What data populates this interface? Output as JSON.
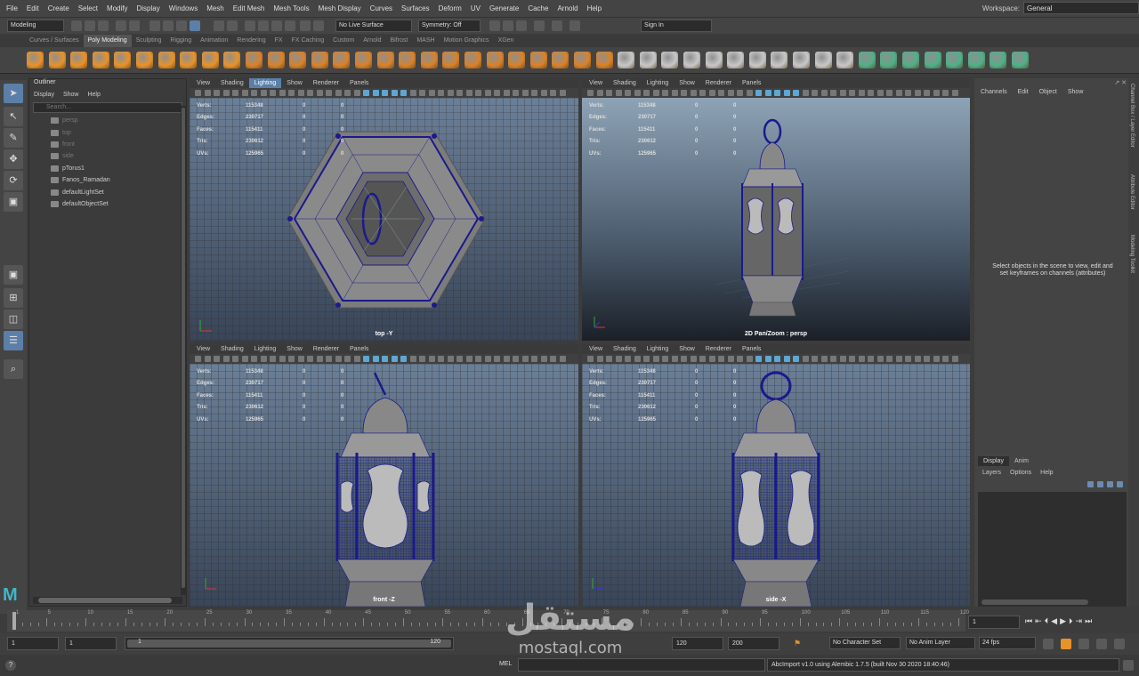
{
  "menubar": {
    "items": [
      "File",
      "Edit",
      "Create",
      "Select",
      "Modify",
      "Display",
      "Windows",
      "Mesh",
      "Edit Mesh",
      "Mesh Tools",
      "Mesh Display",
      "Curves",
      "Surfaces",
      "Deform",
      "UV",
      "Generate",
      "Cache",
      "Arnold",
      "Help"
    ],
    "workspace_label": "Workspace:",
    "workspace_value": "General"
  },
  "statusline": {
    "mode": "Modeling",
    "live_surface": "No Live Surface",
    "symmetry": "Symmetry: Off",
    "signin": "Sign In"
  },
  "shelf": {
    "tabs": [
      "Curves / Surfaces",
      "Poly Modeling",
      "Sculpting",
      "Rigging",
      "Animation",
      "Rendering",
      "FX",
      "FX Caching",
      "Custom",
      "Arnold",
      "Bifrost",
      "MASH",
      "Motion Graphics",
      "XGen"
    ],
    "active_tab": "Poly Modeling"
  },
  "outliner": {
    "title": "Outliner",
    "menu": [
      "Display",
      "Show",
      "Help"
    ],
    "search_placeholder": "Search...",
    "items": [
      {
        "label": "persp",
        "dim": true
      },
      {
        "label": "top",
        "dim": true
      },
      {
        "label": "front",
        "dim": true
      },
      {
        "label": "side",
        "dim": true
      },
      {
        "label": "pTorus1",
        "dim": false
      },
      {
        "label": "Fanos_Ramadan",
        "dim": false
      },
      {
        "label": "defaultLightSet",
        "dim": false
      },
      {
        "label": "defaultObjectSet",
        "dim": false
      }
    ]
  },
  "viewport_menu": [
    "View",
    "Shading",
    "Lighting",
    "Show",
    "Renderer",
    "Panels"
  ],
  "hud": {
    "rows": [
      {
        "k": "Verts:",
        "a": "115348",
        "b": "0",
        "c": "0"
      },
      {
        "k": "Edges:",
        "a": "230717",
        "b": "0",
        "c": "0"
      },
      {
        "k": "Faces:",
        "a": "115411",
        "b": "0",
        "c": "0"
      },
      {
        "k": "Tris:",
        "a": "230612",
        "b": "0",
        "c": "0"
      },
      {
        "k": "UVs:",
        "a": "125965",
        "b": "0",
        "c": "0"
      }
    ]
  },
  "viewports": {
    "top": {
      "label": "top -Y"
    },
    "persp": {
      "label": "2D Pan/Zoom : persp"
    },
    "front": {
      "label": "front -Z"
    },
    "side": {
      "label": "side -X"
    }
  },
  "channelbox": {
    "tabs": [
      "Channels",
      "Edit",
      "Object",
      "Show"
    ],
    "message": "Select objects in the scene to view, edit and set keyframes on channels (attributes)"
  },
  "side_tabs": [
    "Channel Box / Layer Editor",
    "Attribute Editor",
    "Modeling Toolkit"
  ],
  "layer_editor": {
    "tabs": [
      "Display",
      "Anim"
    ],
    "menu": [
      "Layers",
      "Options",
      "Help"
    ]
  },
  "timeslider": {
    "ticks": [
      "1",
      "5",
      "10",
      "15",
      "20",
      "25",
      "30",
      "35",
      "40",
      "45",
      "50",
      "55",
      "60",
      "65",
      "70",
      "75",
      "80",
      "85",
      "90",
      "95",
      "100",
      "105",
      "110",
      "115",
      "120"
    ],
    "current_frame": "1"
  },
  "range": {
    "start": "1",
    "start_inner": "1",
    "range_start": "1",
    "range_end": "120",
    "end_inner": "120",
    "end": "200",
    "character_set": "No Character Set",
    "anim_layer": "No Anim Layer",
    "fps": "24 fps"
  },
  "commandline": {
    "lang": "MEL",
    "message": "AbcImport v1.0 using Alembic 1.7.5 (built Nov 30 2020 18:40:46)"
  },
  "watermark": {
    "arabic": "مستقل",
    "latin": "mostaql.com"
  },
  "colors": {
    "accent_blue": "#5b7fa8",
    "wire_blue": "#1a1a8c",
    "shelf_orange": "#e8922a"
  }
}
